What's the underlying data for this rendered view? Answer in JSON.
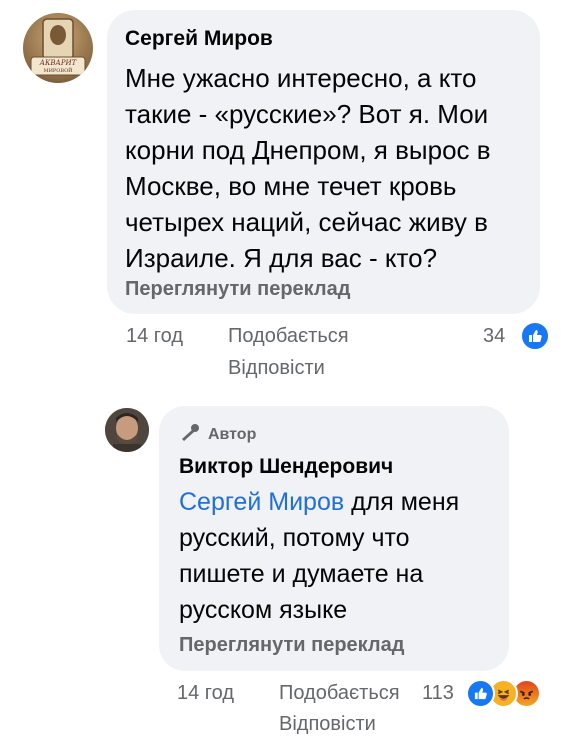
{
  "comments": [
    {
      "author": "Сергей Миров",
      "avatar_lettering": "АКВАРИТ МИРОВОЙ",
      "text": "Мне ужасно интересно, а кто такие - «русские»? Вот я. Мои корни под Днепром, я вырос в Москве, во мне течет кровь четырех наций, сейчас живу в Израиле. Я для вас - кто?",
      "translate_label": "Переглянути переклад",
      "time": "14 год",
      "like_label": "Подобається",
      "reply_label": "Відповісти",
      "reaction_count": "34",
      "reaction_icons": [
        "like-icon"
      ]
    },
    {
      "badge": "Автор",
      "badge_icon": "microphone-icon",
      "author": "Виктор Шендерович",
      "mention": "Сергей Миров",
      "text": " для меня русский, потому что пишете и думаете на русском языке",
      "translate_label": "Переглянути переклад",
      "time": "14 год",
      "like_label": "Подобається",
      "reply_label": "Відповісти",
      "reaction_count": "113",
      "reaction_icons": [
        "like-icon",
        "haha-icon",
        "angry-icon"
      ]
    }
  ],
  "colors": {
    "bubble": "#f0f2f5",
    "secondary_text": "#65676b",
    "link": "#216fdb",
    "like_blue": "#1877f2",
    "haha_yellow": "#f7b125",
    "angry_orange": "#e9710f"
  }
}
